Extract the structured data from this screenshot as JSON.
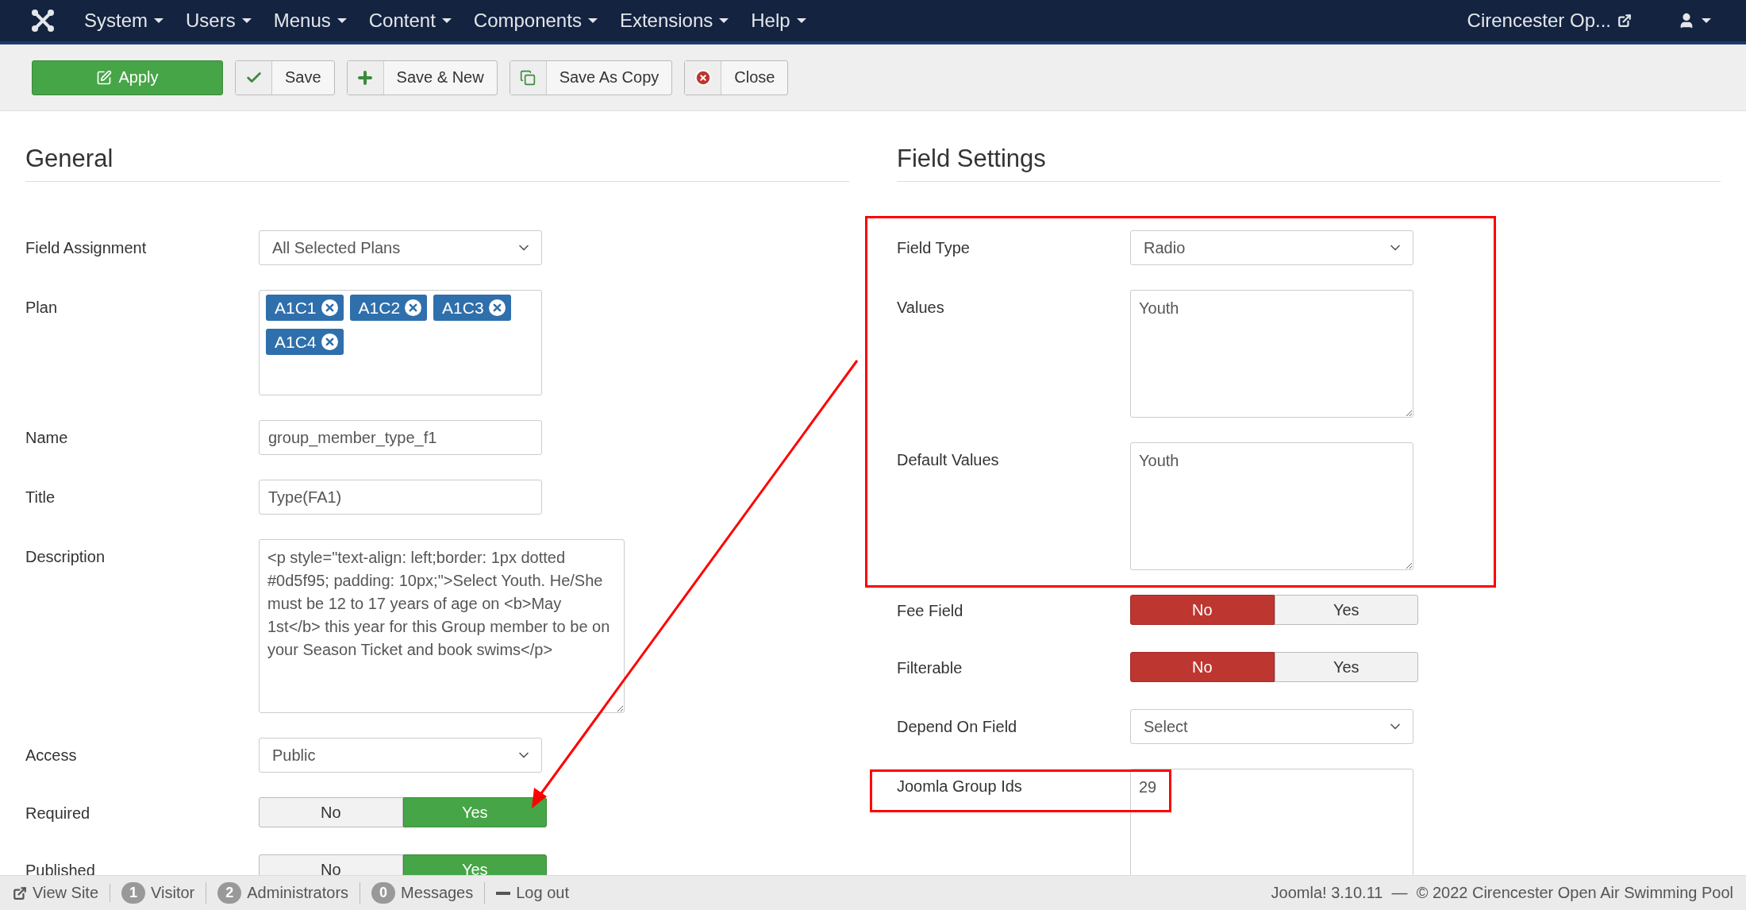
{
  "nav": {
    "menus": [
      {
        "label": "System"
      },
      {
        "label": "Users"
      },
      {
        "label": "Menus"
      },
      {
        "label": "Content"
      },
      {
        "label": "Components"
      },
      {
        "label": "Extensions"
      },
      {
        "label": "Help"
      }
    ],
    "site_link": "Cirencester Op..."
  },
  "toolbar": [
    {
      "label": "Apply",
      "kind": "apply"
    },
    {
      "label": "Save",
      "kind": "save"
    },
    {
      "label": "Save & New",
      "kind": "save-new"
    },
    {
      "label": "Save As Copy",
      "kind": "copy"
    },
    {
      "label": "Close",
      "kind": "close"
    }
  ],
  "general": {
    "heading": "General",
    "fields": [
      {
        "label": "Field Assignment",
        "kind": "select",
        "value": "All Selected Plans"
      },
      {
        "label": "Plan",
        "kind": "tags",
        "tags": [
          "A1C1",
          "A1C2",
          "A1C3",
          "A1C4"
        ]
      },
      {
        "label": "Name",
        "kind": "text",
        "value": "group_member_type_f1"
      },
      {
        "label": "Title",
        "kind": "text",
        "value": "Type(FA1)"
      },
      {
        "label": "Description",
        "kind": "editor",
        "value": "<p style=\"text-align: left;border: 1px dotted #0d5f95; padding: 10px;\">Select Youth. He/She  must be 12 to 17 years of age on <b>May 1st</b> this year for this Group member to be on your Season Ticket and book swims</p>"
      },
      {
        "label": "Access",
        "kind": "select",
        "value": "Public"
      },
      {
        "label": "Required",
        "kind": "toggle",
        "options": [
          {
            "label": "No",
            "kind": "negative",
            "selected": false
          },
          {
            "label": "Yes",
            "kind": "positive",
            "selected": true
          }
        ]
      },
      {
        "label": "Published",
        "kind": "toggle",
        "options": [
          {
            "label": "No",
            "kind": "negative",
            "selected": false
          },
          {
            "label": "Yes",
            "kind": "positive",
            "selected": true
          }
        ]
      }
    ]
  },
  "field_settings": {
    "heading": "Field Settings",
    "fields": [
      {
        "label": "Field Type",
        "kind": "select",
        "value": "Radio"
      },
      {
        "label": "Values",
        "kind": "textarea",
        "value": "Youth"
      },
      {
        "label": "Default Values",
        "kind": "textarea",
        "value": "Youth"
      },
      {
        "label": "Fee Field",
        "kind": "toggle",
        "options": [
          {
            "label": "No",
            "kind": "negative",
            "selected": true
          },
          {
            "label": "Yes",
            "kind": "positive",
            "selected": false
          }
        ]
      },
      {
        "label": "Filterable",
        "kind": "toggle",
        "options": [
          {
            "label": "No",
            "kind": "negative",
            "selected": true
          },
          {
            "label": "Yes",
            "kind": "positive",
            "selected": false
          }
        ]
      },
      {
        "label": "Depend On Field",
        "kind": "select",
        "value": "Select"
      },
      {
        "label": "Joomla Group Ids",
        "kind": "textarea",
        "value": "29"
      }
    ]
  },
  "status_bar": {
    "items": [
      {
        "kind": "link",
        "label": "View Site"
      },
      {
        "kind": "count",
        "count": "1",
        "label": "Visitor"
      },
      {
        "kind": "count",
        "count": "2",
        "label": "Administrators"
      },
      {
        "kind": "count",
        "count": "0",
        "label": "Messages"
      },
      {
        "kind": "logout",
        "label": "Log out"
      }
    ],
    "copyright": "Joomla! 3.10.11  —  © 2022 Cirencester Open Air Swimming Pool"
  }
}
